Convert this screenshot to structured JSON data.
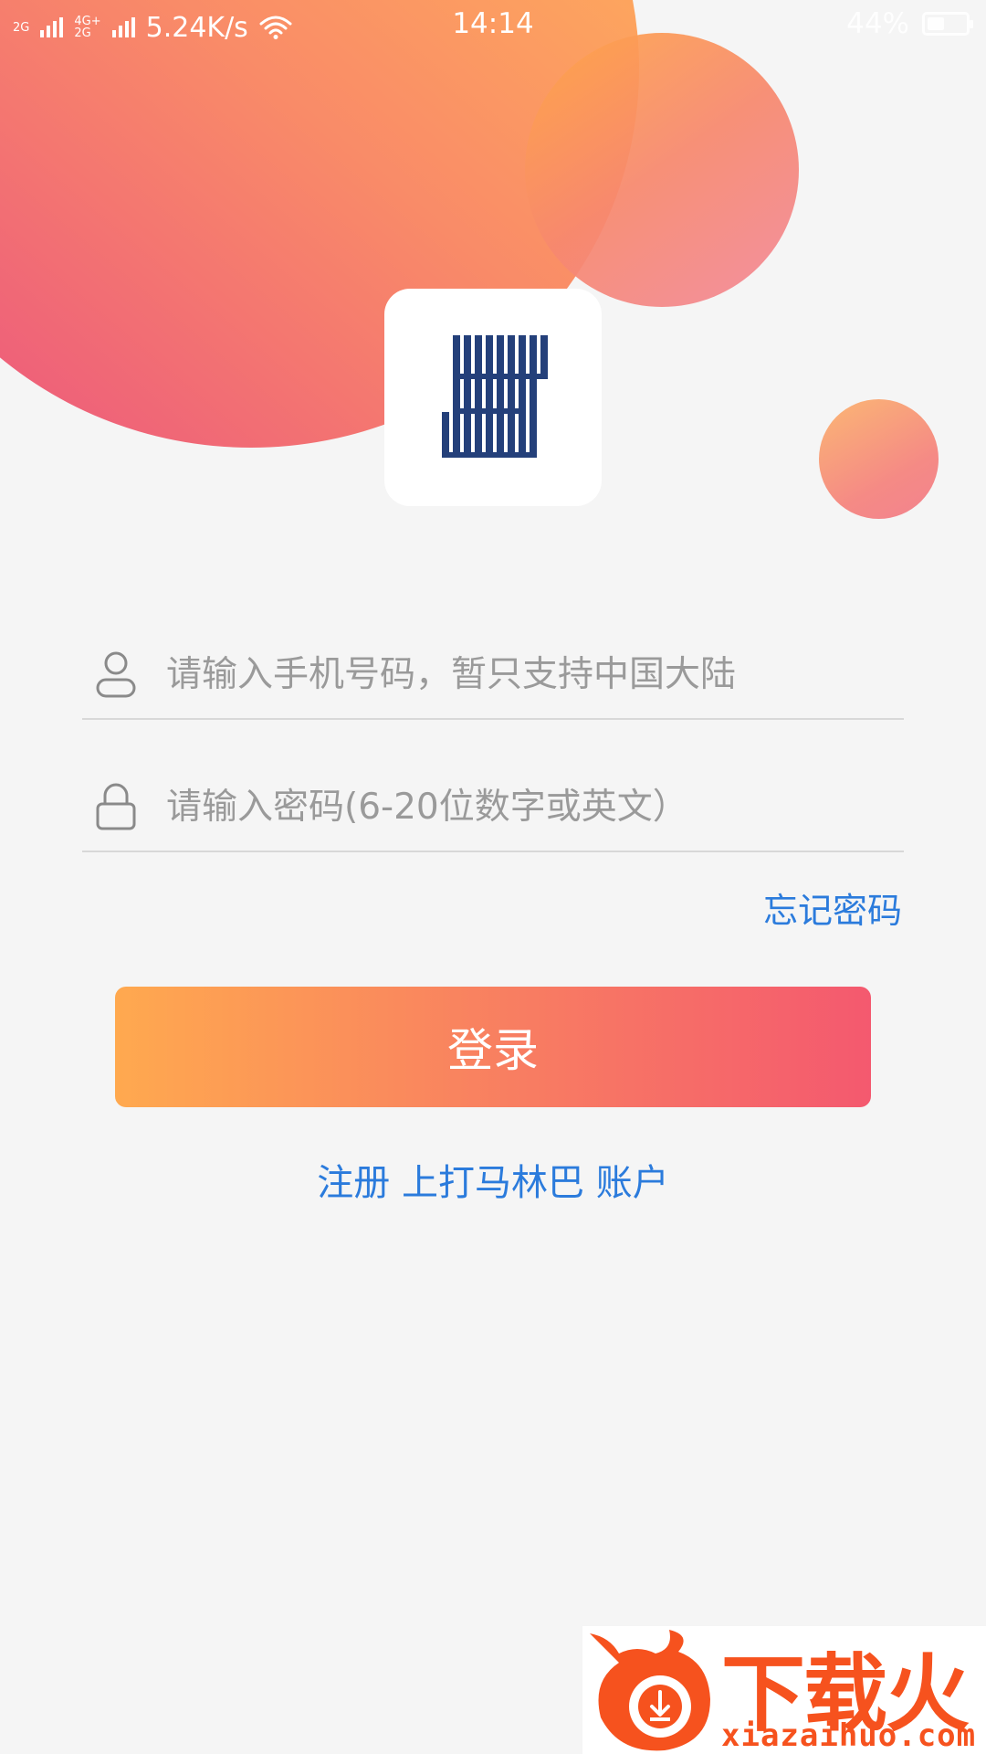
{
  "status_bar": {
    "net_top": "2G",
    "net_mid_top": "4G+",
    "net_mid_bottom": "2G",
    "speed": "5.24K/s",
    "time": "14:14",
    "battery_text": "44%",
    "battery_level": 0.44
  },
  "login": {
    "phone_placeholder": "请输入手机号码，暂只支持中国大陆",
    "password_placeholder": "请输入密码(6-20位数字或英文）",
    "forgot_password": "忘记密码",
    "login_button": "登录",
    "register_link": "注册 上打马林巴 账户"
  },
  "watermark": {
    "text": "下载火",
    "domain": "xiazaihuo.com"
  },
  "colors": {
    "link": "#2b7bdc",
    "button_start": "#ffa94f",
    "button_end": "#f4596f",
    "logo": "#24407a",
    "background": "#f5f5f5"
  },
  "icons": {
    "phone_field": "user-icon",
    "password_field": "lock-icon",
    "signal": "signal-icon",
    "wifi": "wifi-icon",
    "battery": "battery-icon"
  }
}
